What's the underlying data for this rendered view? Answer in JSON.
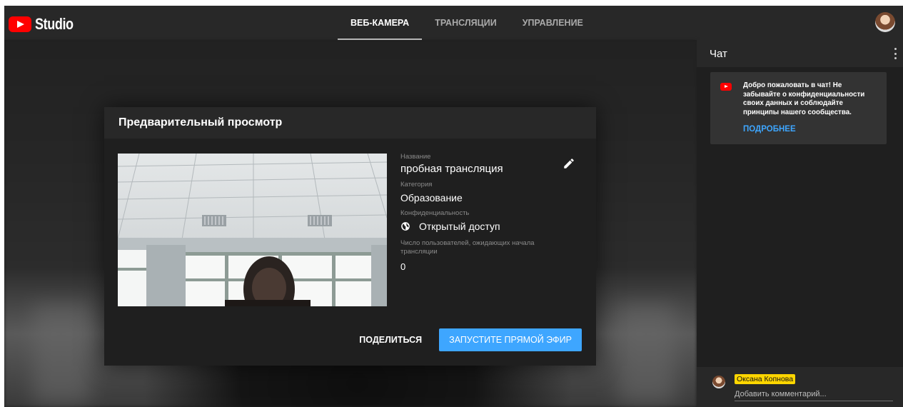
{
  "app": {
    "logo_text": "Studio"
  },
  "tabs": [
    {
      "label": "ВЕБ-КАМЕРА",
      "active": true
    },
    {
      "label": "ТРАНСЛЯЦИИ",
      "active": false
    },
    {
      "label": "УПРАВЛЕНИЕ",
      "active": false
    }
  ],
  "dialog": {
    "title": "Предварительный просмотр",
    "fields": {
      "title_label": "Название",
      "title_value": "пробная трансляция",
      "category_label": "Категория",
      "category_value": "Образование",
      "privacy_label": "Конфиденциальность",
      "privacy_value": "Открытый доступ",
      "waiting_label": "Число пользователей, ожидающих начала трансляции",
      "waiting_value": "0"
    },
    "share_label": "ПОДЕЛИТЬСЯ",
    "golive_label": "ЗАПУСТИТЕ ПРЯМОЙ ЭФИР"
  },
  "chat": {
    "title": "Чат",
    "welcome_text": "Добро пожаловать в чат! Не забывайте о конфиденциальности своих данных и соблюдайте принципы нашего сообщества.",
    "more_link": "ПОДРОБНЕЕ",
    "username": "Оксана Копнова",
    "comment_placeholder": "Добавить комментарий..."
  },
  "colors": {
    "accent_blue": "#3ea6ff",
    "youtube_red": "#ff0000",
    "username_badge": "#ffd600",
    "background": "#1f1f1f",
    "topbar": "#282828"
  },
  "icons": [
    "youtube-logo-icon",
    "pencil-edit-icon",
    "globe-icon",
    "more-vert-icon",
    "youtube-small-icon"
  ]
}
